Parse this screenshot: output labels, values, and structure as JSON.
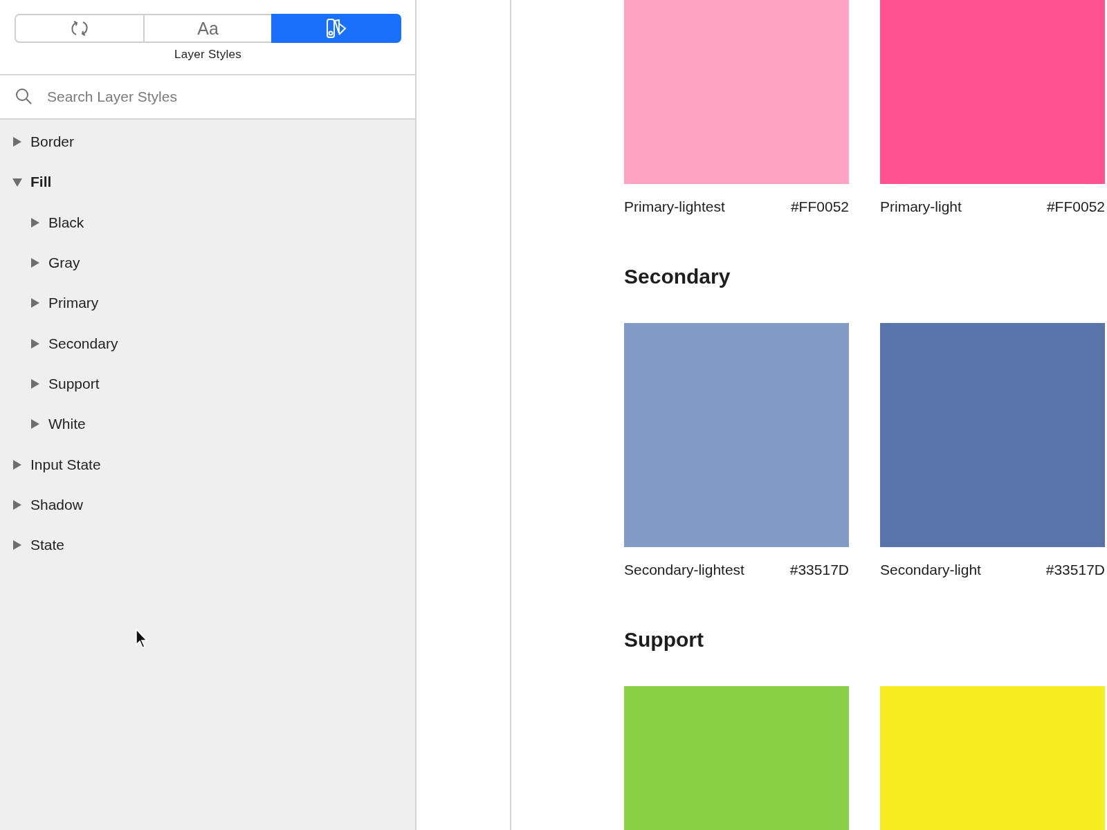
{
  "segments": [
    {
      "kind": "sync",
      "selected": false
    },
    {
      "kind": "text",
      "label": "Aa",
      "selected": false
    },
    {
      "kind": "swatch",
      "selected": true
    }
  ],
  "segment_caption": "Layer Styles",
  "search": {
    "placeholder": "Search Layer Styles"
  },
  "tree": [
    {
      "label": "Border",
      "expanded": false
    },
    {
      "label": "Fill",
      "expanded": true,
      "children": [
        {
          "label": "Black",
          "expanded": false
        },
        {
          "label": "Gray",
          "expanded": false
        },
        {
          "label": "Primary",
          "expanded": false
        },
        {
          "label": "Secondary",
          "expanded": false
        },
        {
          "label": "Support",
          "expanded": false
        },
        {
          "label": "White",
          "expanded": false
        }
      ]
    },
    {
      "label": "Input State",
      "expanded": false
    },
    {
      "label": "Shadow",
      "expanded": false
    },
    {
      "label": "State",
      "expanded": false
    }
  ],
  "groups": [
    {
      "swatches": [
        {
          "name": "Primary-lightest",
          "hex": "#FF0052",
          "color": "#ffa3c2"
        },
        {
          "name": "Primary-light",
          "hex": "#FF0052",
          "color": "#ff528e"
        }
      ]
    },
    {
      "title": "Secondary",
      "swatches": [
        {
          "name": "Secondary-lightest",
          "hex": "#33517D",
          "color": "#829cc6"
        },
        {
          "name": "Secondary-light",
          "hex": "#33517D",
          "color": "#5874aa"
        }
      ]
    },
    {
      "title": "Support",
      "swatches": [
        {
          "color": "#8bd147"
        },
        {
          "color": "#f6ec22"
        }
      ]
    }
  ]
}
